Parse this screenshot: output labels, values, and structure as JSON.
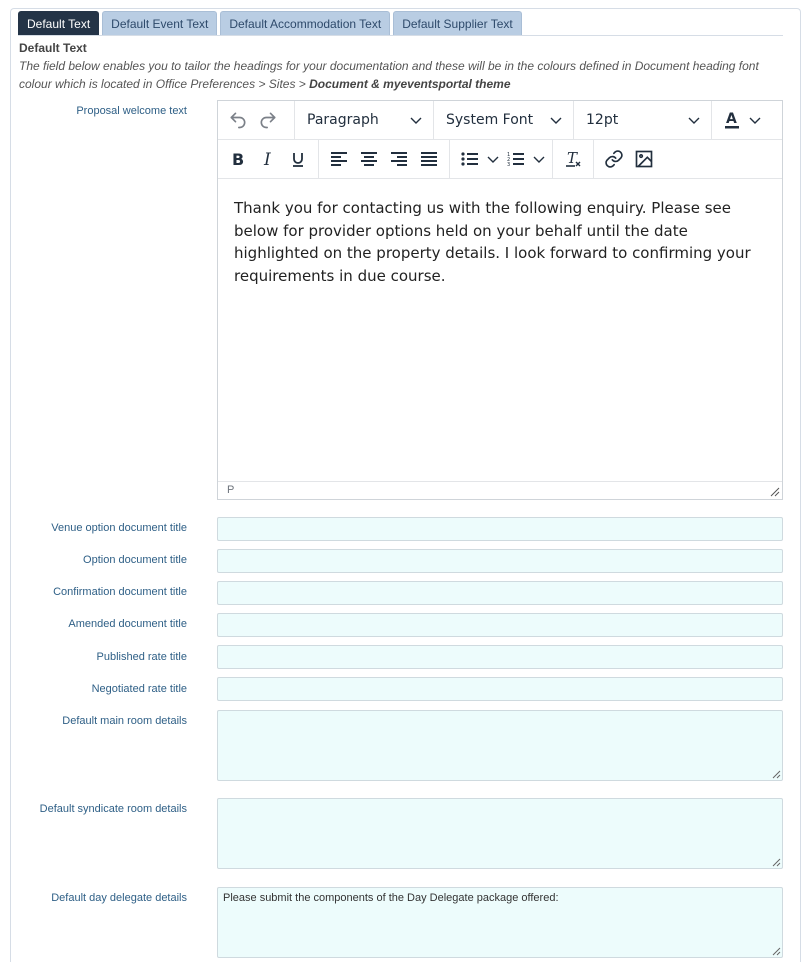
{
  "tabs": [
    {
      "label": "Default Text",
      "active": true
    },
    {
      "label": "Default Event Text",
      "active": false
    },
    {
      "label": "Default Accommodation Text",
      "active": false
    },
    {
      "label": "Default Supplier Text",
      "active": false
    }
  ],
  "section": {
    "title": "Default Text",
    "description": "The field below enables you to tailor the headings for your documentation and these will be in the colours defined in Document heading font colour which is located in Office Preferences > Sites > ",
    "description_bold": "Document & myeventsportal theme"
  },
  "editor": {
    "label": "Proposal welcome text",
    "block_format": "Paragraph",
    "font_family": "System Font",
    "font_size": "12pt",
    "content": "Thank you for contacting us with the following enquiry.  Please see below for provider options held on your behalf until the date highlighted on the property details.  I look forward to confirming your requirements in due course.",
    "status_path": "P",
    "text_color_underline": "#222f3e"
  },
  "fields": [
    {
      "label": "Venue option document title",
      "value": ""
    },
    {
      "label": "Option document title",
      "value": ""
    },
    {
      "label": "Confirmation document title",
      "value": ""
    },
    {
      "label": "Amended document title",
      "value": ""
    },
    {
      "label": "Published rate title",
      "value": ""
    },
    {
      "label": "Negotiated rate title",
      "value": ""
    }
  ],
  "textareas": [
    {
      "label": "Default main room details",
      "value": ""
    },
    {
      "label": "Default syndicate room details",
      "value": ""
    },
    {
      "label": "Default day delegate details",
      "value": "Please submit the components of the Day Delegate package offered:"
    }
  ],
  "colors": {
    "active_tab": "#243447",
    "inactive_tab": "#b9cde3",
    "label": "#2e5f86",
    "field_bg": "#edfcfc"
  }
}
